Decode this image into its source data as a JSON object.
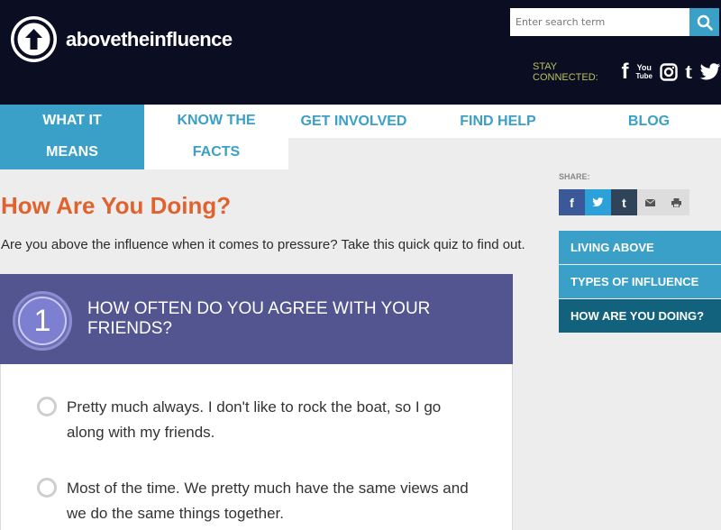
{
  "header": {
    "logo_text": "abovetheinfluence",
    "search_placeholder": "Enter search term",
    "stay_connected": "STAY CONNECTED:",
    "social": {
      "facebook": "f",
      "youtube_top": "You",
      "youtube_bottom": "Tube",
      "tumblr": "t"
    }
  },
  "nav": {
    "what_it_means": "WHAT IT MEANS",
    "know_the_facts": "KNOW THE FACTS",
    "get_involved": "GET INVOLVED",
    "find_help": "FIND HELP",
    "blog": "BLOG"
  },
  "main": {
    "title": "How Are You Doing?",
    "intro": "Are you above the influence when it comes to pressure? Take this quick quiz to find out.",
    "question": {
      "number": "1",
      "text": "HOW OFTEN DO YOU AGREE WITH YOUR FRIENDS?",
      "options": [
        "Pretty much always. I don't like to rock the boat, so I go along with my friends.",
        "Most of the time. We pretty much have the same views and we do the same things together."
      ]
    }
  },
  "sidebar": {
    "share_label": "SHARE:",
    "share_buttons": {
      "facebook": "f",
      "tumblr": "t"
    },
    "nav": [
      "LIVING ABOVE",
      "TYPES OF INFLUENCE",
      "HOW ARE YOU DOING?"
    ]
  },
  "colors": {
    "header_bg": "#0b0d22",
    "accent_blue": "#3aa0c7",
    "title_orange": "#e0622f",
    "quiz_purple": "#535590",
    "active_nav": "#13627d"
  }
}
